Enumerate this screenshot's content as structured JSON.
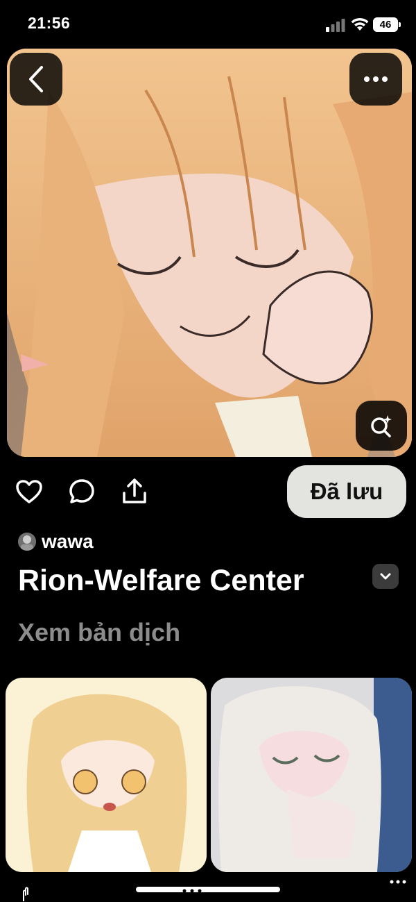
{
  "status_bar": {
    "time": "21:56",
    "battery": "46"
  },
  "hero": {
    "back_icon": "chevron-left-icon",
    "more_icon": "more-horizontal-icon",
    "lens_icon": "visual-search-icon"
  },
  "actions": {
    "like_icon": "heart-icon",
    "comment_icon": "comment-icon",
    "share_icon": "share-icon",
    "saved_label": "Đã lưu"
  },
  "pin": {
    "author": "wawa",
    "title": "Rion-Welfare Center",
    "translate_label": "Xem bản dịch"
  },
  "colors": {
    "background": "#000000",
    "saved_button": "#e3e3df",
    "muted_text": "#8c8c8c"
  }
}
